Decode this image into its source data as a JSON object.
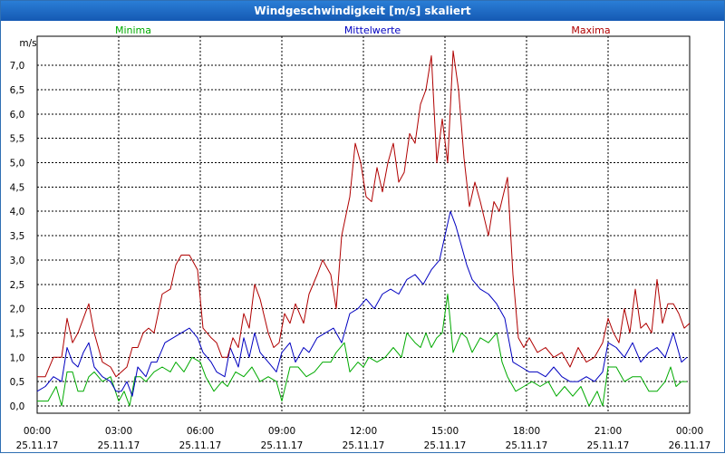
{
  "window": {
    "title": "Windgeschwindigkeit [m/s] skaliert"
  },
  "chart_data": {
    "type": "line",
    "title": "Windgeschwindigkeit [m/s] skaliert",
    "ylabel": "m/s",
    "xlabel": "",
    "ylim": [
      -0.15,
      7.6
    ],
    "xlim": [
      0,
      24
    ],
    "grid": true,
    "legend_placement": "top",
    "yticks": [
      {
        "value": 0.0,
        "label": "0,0"
      },
      {
        "value": 0.5,
        "label": "0,5"
      },
      {
        "value": 1.0,
        "label": "1,0"
      },
      {
        "value": 1.5,
        "label": "1,5"
      },
      {
        "value": 2.0,
        "label": "2,0"
      },
      {
        "value": 2.5,
        "label": "2,5"
      },
      {
        "value": 3.0,
        "label": "3,0"
      },
      {
        "value": 3.5,
        "label": "3,5"
      },
      {
        "value": 4.0,
        "label": "4,0"
      },
      {
        "value": 4.5,
        "label": "4,5"
      },
      {
        "value": 5.0,
        "label": "5,0"
      },
      {
        "value": 5.5,
        "label": "5,5"
      },
      {
        "value": 6.0,
        "label": "6,0"
      },
      {
        "value": 6.5,
        "label": "6,5"
      },
      {
        "value": 7.0,
        "label": "7,0"
      }
    ],
    "xticks": [
      {
        "value": 0,
        "time": "00:00",
        "date": "25.11.17"
      },
      {
        "value": 3,
        "time": "03:00",
        "date": "25.11.17"
      },
      {
        "value": 6,
        "time": "06:00",
        "date": "25.11.17"
      },
      {
        "value": 9,
        "time": "09:00",
        "date": "25.11.17"
      },
      {
        "value": 12,
        "time": "12:00",
        "date": "25.11.17"
      },
      {
        "value": 15,
        "time": "15:00",
        "date": "25.11.17"
      },
      {
        "value": 18,
        "time": "18:00",
        "date": "25.11.17"
      },
      {
        "value": 21,
        "time": "21:00",
        "date": "25.11.17"
      },
      {
        "value": 24,
        "time": "00:00",
        "date": "26.11.17"
      }
    ],
    "series": [
      {
        "name": "Minima",
        "color": "#00aa00",
        "legend_position": "left",
        "points": [
          [
            0.0,
            0.1
          ],
          [
            0.4,
            0.1
          ],
          [
            0.7,
            0.4
          ],
          [
            0.9,
            0.0
          ],
          [
            1.1,
            0.7
          ],
          [
            1.3,
            0.7
          ],
          [
            1.5,
            0.3
          ],
          [
            1.7,
            0.3
          ],
          [
            1.9,
            0.6
          ],
          [
            2.1,
            0.7
          ],
          [
            2.4,
            0.5
          ],
          [
            2.7,
            0.6
          ],
          [
            3.0,
            0.1
          ],
          [
            3.2,
            0.3
          ],
          [
            3.4,
            0.0
          ],
          [
            3.6,
            0.6
          ],
          [
            3.8,
            0.6
          ],
          [
            4.0,
            0.5
          ],
          [
            4.3,
            0.7
          ],
          [
            4.6,
            0.8
          ],
          [
            4.9,
            0.7
          ],
          [
            5.1,
            0.9
          ],
          [
            5.4,
            0.7
          ],
          [
            5.7,
            1.0
          ],
          [
            6.0,
            0.9
          ],
          [
            6.2,
            0.6
          ],
          [
            6.5,
            0.3
          ],
          [
            6.8,
            0.5
          ],
          [
            7.0,
            0.4
          ],
          [
            7.3,
            0.7
          ],
          [
            7.6,
            0.6
          ],
          [
            7.9,
            0.8
          ],
          [
            8.2,
            0.5
          ],
          [
            8.5,
            0.6
          ],
          [
            8.8,
            0.5
          ],
          [
            9.0,
            0.1
          ],
          [
            9.3,
            0.8
          ],
          [
            9.6,
            0.8
          ],
          [
            9.9,
            0.6
          ],
          [
            10.2,
            0.7
          ],
          [
            10.5,
            0.9
          ],
          [
            10.8,
            0.9
          ],
          [
            11.0,
            1.1
          ],
          [
            11.3,
            1.3
          ],
          [
            11.5,
            0.7
          ],
          [
            11.8,
            0.9
          ],
          [
            12.0,
            0.8
          ],
          [
            12.2,
            1.0
          ],
          [
            12.5,
            0.9
          ],
          [
            12.8,
            1.0
          ],
          [
            13.1,
            1.2
          ],
          [
            13.4,
            1.0
          ],
          [
            13.6,
            1.5
          ],
          [
            13.9,
            1.3
          ],
          [
            14.1,
            1.2
          ],
          [
            14.3,
            1.5
          ],
          [
            14.5,
            1.2
          ],
          [
            14.7,
            1.4
          ],
          [
            14.9,
            1.5
          ],
          [
            15.1,
            2.3
          ],
          [
            15.3,
            1.1
          ],
          [
            15.6,
            1.5
          ],
          [
            15.8,
            1.4
          ],
          [
            16.0,
            1.1
          ],
          [
            16.3,
            1.4
          ],
          [
            16.6,
            1.3
          ],
          [
            16.9,
            1.5
          ],
          [
            17.1,
            0.9
          ],
          [
            17.3,
            0.6
          ],
          [
            17.6,
            0.3
          ],
          [
            17.9,
            0.4
          ],
          [
            18.2,
            0.5
          ],
          [
            18.5,
            0.4
          ],
          [
            18.8,
            0.5
          ],
          [
            19.1,
            0.2
          ],
          [
            19.4,
            0.4
          ],
          [
            19.7,
            0.2
          ],
          [
            20.0,
            0.4
          ],
          [
            20.3,
            0.0
          ],
          [
            20.6,
            0.3
          ],
          [
            20.8,
            0.0
          ],
          [
            21.0,
            0.8
          ],
          [
            21.3,
            0.8
          ],
          [
            21.6,
            0.5
          ],
          [
            21.9,
            0.6
          ],
          [
            22.2,
            0.6
          ],
          [
            22.5,
            0.3
          ],
          [
            22.8,
            0.3
          ],
          [
            23.1,
            0.5
          ],
          [
            23.3,
            0.8
          ],
          [
            23.5,
            0.4
          ],
          [
            23.7,
            0.5
          ],
          [
            23.9,
            0.5
          ]
        ]
      },
      {
        "name": "Mittelwerte",
        "color": "#0000c0",
        "legend_position": "center",
        "points": [
          [
            0.0,
            0.3
          ],
          [
            0.3,
            0.4
          ],
          [
            0.6,
            0.6
          ],
          [
            0.9,
            0.5
          ],
          [
            1.1,
            1.2
          ],
          [
            1.3,
            0.9
          ],
          [
            1.5,
            0.8
          ],
          [
            1.7,
            1.1
          ],
          [
            1.9,
            1.3
          ],
          [
            2.1,
            0.8
          ],
          [
            2.4,
            0.6
          ],
          [
            2.7,
            0.5
          ],
          [
            2.9,
            0.3
          ],
          [
            3.1,
            0.3
          ],
          [
            3.3,
            0.5
          ],
          [
            3.5,
            0.2
          ],
          [
            3.7,
            0.8
          ],
          [
            4.0,
            0.6
          ],
          [
            4.2,
            0.9
          ],
          [
            4.4,
            0.9
          ],
          [
            4.7,
            1.3
          ],
          [
            5.0,
            1.4
          ],
          [
            5.3,
            1.5
          ],
          [
            5.6,
            1.6
          ],
          [
            5.9,
            1.4
          ],
          [
            6.1,
            1.1
          ],
          [
            6.4,
            0.9
          ],
          [
            6.6,
            0.7
          ],
          [
            6.9,
            0.6
          ],
          [
            7.1,
            1.2
          ],
          [
            7.4,
            0.8
          ],
          [
            7.6,
            1.4
          ],
          [
            7.8,
            1.0
          ],
          [
            8.0,
            1.5
          ],
          [
            8.2,
            1.1
          ],
          [
            8.5,
            0.9
          ],
          [
            8.8,
            0.7
          ],
          [
            9.0,
            1.1
          ],
          [
            9.3,
            1.3
          ],
          [
            9.5,
            0.9
          ],
          [
            9.8,
            1.2
          ],
          [
            10.0,
            1.1
          ],
          [
            10.3,
            1.4
          ],
          [
            10.6,
            1.5
          ],
          [
            10.9,
            1.6
          ],
          [
            11.2,
            1.3
          ],
          [
            11.5,
            1.9
          ],
          [
            11.8,
            2.0
          ],
          [
            12.1,
            2.2
          ],
          [
            12.4,
            2.0
          ],
          [
            12.7,
            2.3
          ],
          [
            13.0,
            2.4
          ],
          [
            13.3,
            2.3
          ],
          [
            13.6,
            2.6
          ],
          [
            13.9,
            2.7
          ],
          [
            14.2,
            2.5
          ],
          [
            14.5,
            2.8
          ],
          [
            14.8,
            3.0
          ],
          [
            15.0,
            3.5
          ],
          [
            15.2,
            4.0
          ],
          [
            15.4,
            3.7
          ],
          [
            15.6,
            3.3
          ],
          [
            15.8,
            2.9
          ],
          [
            16.0,
            2.6
          ],
          [
            16.3,
            2.4
          ],
          [
            16.6,
            2.3
          ],
          [
            16.9,
            2.1
          ],
          [
            17.2,
            1.8
          ],
          [
            17.5,
            0.9
          ],
          [
            17.8,
            0.8
          ],
          [
            18.1,
            0.7
          ],
          [
            18.4,
            0.7
          ],
          [
            18.7,
            0.6
          ],
          [
            19.0,
            0.8
          ],
          [
            19.3,
            0.6
          ],
          [
            19.6,
            0.5
          ],
          [
            19.9,
            0.5
          ],
          [
            20.2,
            0.6
          ],
          [
            20.5,
            0.5
          ],
          [
            20.8,
            0.7
          ],
          [
            21.0,
            1.3
          ],
          [
            21.3,
            1.2
          ],
          [
            21.6,
            1.0
          ],
          [
            21.9,
            1.3
          ],
          [
            22.2,
            0.9
          ],
          [
            22.5,
            1.1
          ],
          [
            22.8,
            1.2
          ],
          [
            23.1,
            1.0
          ],
          [
            23.4,
            1.5
          ],
          [
            23.7,
            0.9
          ],
          [
            23.9,
            1.0
          ]
        ]
      },
      {
        "name": "Maxima",
        "color": "#b00000",
        "legend_position": "right",
        "points": [
          [
            0.0,
            0.6
          ],
          [
            0.3,
            0.6
          ],
          [
            0.6,
            1.0
          ],
          [
            0.9,
            1.0
          ],
          [
            1.1,
            1.8
          ],
          [
            1.3,
            1.3
          ],
          [
            1.5,
            1.5
          ],
          [
            1.7,
            1.8
          ],
          [
            1.9,
            2.1
          ],
          [
            2.1,
            1.5
          ],
          [
            2.4,
            0.9
          ],
          [
            2.7,
            0.8
          ],
          [
            2.9,
            0.6
          ],
          [
            3.1,
            0.7
          ],
          [
            3.3,
            0.8
          ],
          [
            3.5,
            1.2
          ],
          [
            3.7,
            1.2
          ],
          [
            3.9,
            1.5
          ],
          [
            4.1,
            1.6
          ],
          [
            4.3,
            1.5
          ],
          [
            4.6,
            2.3
          ],
          [
            4.9,
            2.4
          ],
          [
            5.1,
            2.9
          ],
          [
            5.3,
            3.1
          ],
          [
            5.6,
            3.1
          ],
          [
            5.9,
            2.8
          ],
          [
            6.1,
            1.6
          ],
          [
            6.4,
            1.4
          ],
          [
            6.6,
            1.3
          ],
          [
            6.8,
            1.0
          ],
          [
            7.0,
            1.0
          ],
          [
            7.2,
            1.4
          ],
          [
            7.4,
            1.2
          ],
          [
            7.6,
            1.9
          ],
          [
            7.8,
            1.6
          ],
          [
            8.0,
            2.5
          ],
          [
            8.2,
            2.2
          ],
          [
            8.5,
            1.5
          ],
          [
            8.7,
            1.2
          ],
          [
            8.9,
            1.3
          ],
          [
            9.1,
            1.9
          ],
          [
            9.3,
            1.7
          ],
          [
            9.5,
            2.1
          ],
          [
            9.8,
            1.7
          ],
          [
            10.0,
            2.3
          ],
          [
            10.3,
            2.7
          ],
          [
            10.5,
            3.0
          ],
          [
            10.8,
            2.7
          ],
          [
            11.0,
            2.0
          ],
          [
            11.2,
            3.5
          ],
          [
            11.5,
            4.3
          ],
          [
            11.7,
            5.4
          ],
          [
            11.9,
            5.0
          ],
          [
            12.1,
            4.3
          ],
          [
            12.3,
            4.2
          ],
          [
            12.5,
            4.9
          ],
          [
            12.7,
            4.4
          ],
          [
            12.9,
            5.0
          ],
          [
            13.1,
            5.4
          ],
          [
            13.3,
            4.6
          ],
          [
            13.5,
            4.8
          ],
          [
            13.7,
            5.6
          ],
          [
            13.9,
            5.4
          ],
          [
            14.1,
            6.2
          ],
          [
            14.3,
            6.5
          ],
          [
            14.5,
            7.2
          ],
          [
            14.7,
            5.0
          ],
          [
            14.9,
            5.9
          ],
          [
            15.1,
            5.0
          ],
          [
            15.3,
            7.3
          ],
          [
            15.5,
            6.5
          ],
          [
            15.7,
            5.1
          ],
          [
            15.9,
            4.1
          ],
          [
            16.1,
            4.6
          ],
          [
            16.3,
            4.2
          ],
          [
            16.6,
            3.5
          ],
          [
            16.8,
            4.2
          ],
          [
            17.0,
            4.0
          ],
          [
            17.3,
            4.7
          ],
          [
            17.5,
            2.7
          ],
          [
            17.7,
            1.4
          ],
          [
            17.9,
            1.2
          ],
          [
            18.1,
            1.4
          ],
          [
            18.4,
            1.1
          ],
          [
            18.7,
            1.2
          ],
          [
            19.0,
            1.0
          ],
          [
            19.3,
            1.1
          ],
          [
            19.6,
            0.8
          ],
          [
            19.9,
            1.2
          ],
          [
            20.2,
            0.9
          ],
          [
            20.5,
            1.0
          ],
          [
            20.8,
            1.3
          ],
          [
            21.0,
            1.8
          ],
          [
            21.2,
            1.5
          ],
          [
            21.4,
            1.3
          ],
          [
            21.6,
            2.0
          ],
          [
            21.8,
            1.5
          ],
          [
            22.0,
            2.4
          ],
          [
            22.2,
            1.6
          ],
          [
            22.4,
            1.7
          ],
          [
            22.6,
            1.5
          ],
          [
            22.8,
            2.6
          ],
          [
            23.0,
            1.7
          ],
          [
            23.2,
            2.1
          ],
          [
            23.4,
            2.1
          ],
          [
            23.6,
            1.9
          ],
          [
            23.8,
            1.6
          ],
          [
            24.0,
            1.7
          ]
        ]
      }
    ]
  }
}
